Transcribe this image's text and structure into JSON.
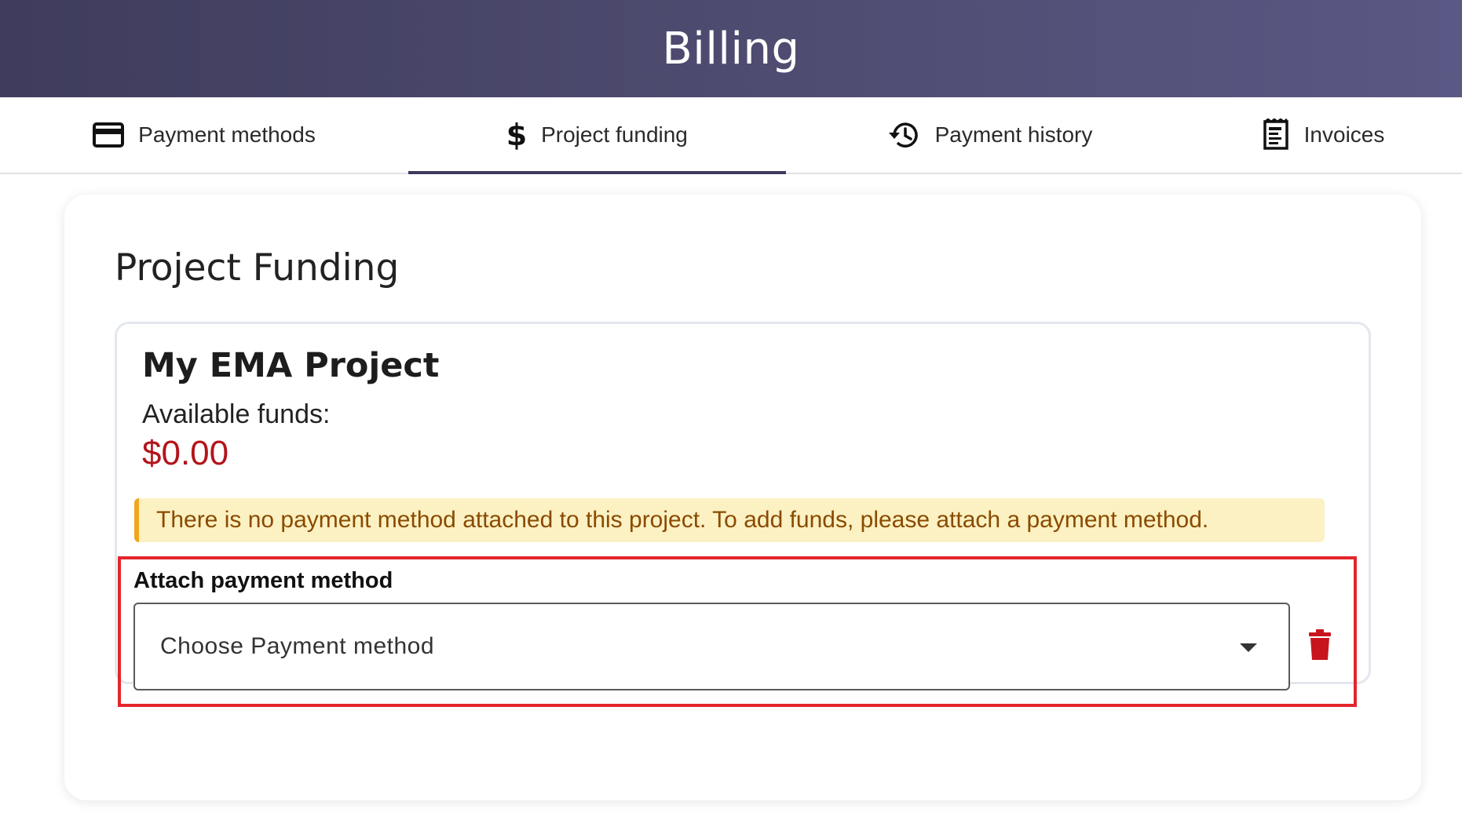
{
  "header": {
    "title": "Billing"
  },
  "tabs": [
    {
      "label": "Payment methods",
      "icon": "credit-card-icon"
    },
    {
      "label": "Project funding",
      "icon": "dollar-icon",
      "active": true
    },
    {
      "label": "Payment history",
      "icon": "history-icon"
    },
    {
      "label": "Invoices",
      "icon": "receipt-icon"
    }
  ],
  "card": {
    "title": "Project Funding",
    "project": {
      "name": "My EMA Project",
      "funds_label": "Available funds:",
      "funds_value": "$0.00"
    },
    "alert": "There is no payment method attached to this project. To add funds, please attach a payment method.",
    "attach": {
      "label": "Attach payment method",
      "select_value": "Choose Payment method",
      "delete_icon": "trash-icon"
    }
  },
  "colors": {
    "header_bg": "#4a4769",
    "active_tab": "#3e3a5c",
    "funds_red": "#b3141b",
    "alert_bg": "#fcf1c2",
    "alert_border": "#f0a61c",
    "alert_text": "#8a4a00",
    "highlight_border": "#e3262b",
    "trash": "#c8141c"
  }
}
